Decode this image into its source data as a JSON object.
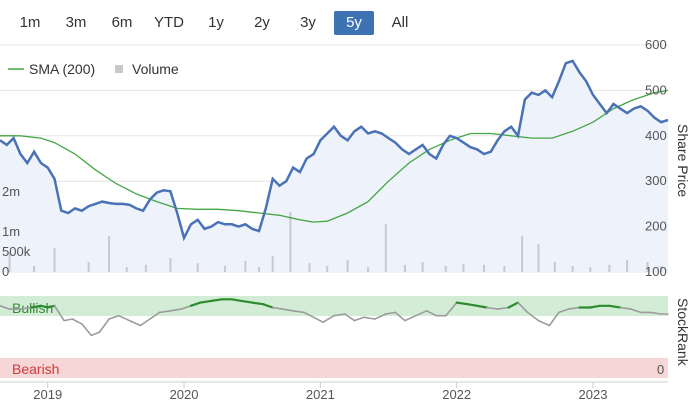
{
  "range_selector": {
    "buttons": [
      {
        "label": "1m"
      },
      {
        "label": "3m"
      },
      {
        "label": "6m"
      },
      {
        "label": "YTD"
      },
      {
        "label": "1y"
      },
      {
        "label": "2y"
      },
      {
        "label": "3y"
      },
      {
        "label": "5y"
      },
      {
        "label": "All"
      }
    ],
    "active": "5y"
  },
  "colors": {
    "price": "#4a72b6",
    "price_fill": "#eef2fa",
    "sma": "#44a744",
    "volume": "#c9c9cb",
    "stockrank_neutral": "#9c9c9c",
    "stockrank_bullish": "#2e8b2e",
    "bullish_band": "#d2ecd6",
    "bearish_band": "#f6d6d6"
  },
  "chart_data": [
    {
      "type": "line",
      "legend": [
        {
          "name": "SMA (200)",
          "marker": "line"
        },
        {
          "name": "Volume",
          "marker": "square"
        }
      ],
      "y_right_label": "Share Price",
      "y_right_ticks": [
        "600",
        "500",
        "400",
        "300",
        "200",
        "100"
      ],
      "y_right_range": [
        100,
        600
      ],
      "y_left_ticks": [
        "2m",
        "1m",
        "500k",
        "0"
      ],
      "y_left_range": [
        0,
        3000000
      ],
      "x_ticks": [
        "2019",
        "2020",
        "2021",
        "2022",
        "2023"
      ],
      "x_range": [
        2018.65,
        2023.55
      ],
      "grid": true,
      "series": [
        {
          "name": "Share Price",
          "x": [
            2018.65,
            2018.7,
            2018.75,
            2018.8,
            2018.85,
            2018.9,
            2018.95,
            2019.0,
            2019.05,
            2019.1,
            2019.15,
            2019.2,
            2019.25,
            2019.3,
            2019.35,
            2019.4,
            2019.45,
            2019.5,
            2019.55,
            2019.6,
            2019.65,
            2019.7,
            2019.75,
            2019.8,
            2019.85,
            2019.9,
            2019.95,
            2020.0,
            2020.05,
            2020.1,
            2020.15,
            2020.2,
            2020.25,
            2020.3,
            2020.35,
            2020.4,
            2020.45,
            2020.5,
            2020.55,
            2020.6,
            2020.65,
            2020.7,
            2020.75,
            2020.8,
            2020.85,
            2020.9,
            2020.95,
            2021.0,
            2021.05,
            2021.1,
            2021.15,
            2021.2,
            2021.25,
            2021.3,
            2021.35,
            2021.4,
            2021.45,
            2021.5,
            2021.55,
            2021.6,
            2021.65,
            2021.7,
            2021.75,
            2021.8,
            2021.85,
            2021.9,
            2021.95,
            2022.0,
            2022.05,
            2022.1,
            2022.15,
            2022.2,
            2022.25,
            2022.3,
            2022.35,
            2022.4,
            2022.45,
            2022.5,
            2022.55,
            2022.6,
            2022.65,
            2022.7,
            2022.75,
            2022.8,
            2022.85,
            2022.9,
            2022.95,
            2023.0,
            2023.05,
            2023.1,
            2023.15,
            2023.2,
            2023.25,
            2023.3,
            2023.35,
            2023.4,
            2023.45,
            2023.5,
            2023.55
          ],
          "y": [
            390,
            380,
            395,
            360,
            340,
            365,
            340,
            330,
            305,
            235,
            230,
            240,
            235,
            245,
            250,
            255,
            252,
            250,
            250,
            248,
            240,
            235,
            260,
            275,
            280,
            278,
            230,
            175,
            205,
            215,
            195,
            200,
            210,
            205,
            205,
            200,
            205,
            195,
            190,
            240,
            305,
            290,
            300,
            330,
            320,
            350,
            360,
            390,
            405,
            420,
            400,
            390,
            410,
            420,
            405,
            410,
            405,
            395,
            385,
            370,
            360,
            370,
            380,
            360,
            350,
            380,
            400,
            395,
            385,
            375,
            370,
            360,
            365,
            390,
            410,
            420,
            400,
            480,
            495,
            490,
            500,
            485,
            520,
            560,
            565,
            540,
            520,
            490,
            470,
            450,
            470,
            460,
            450,
            460,
            465,
            455,
            440,
            430,
            435
          ]
        },
        {
          "name": "SMA (200)",
          "x": [
            2018.65,
            2018.8,
            2018.95,
            2019.05,
            2019.2,
            2019.35,
            2019.5,
            2019.65,
            2019.8,
            2019.95,
            2020.1,
            2020.25,
            2020.4,
            2020.55,
            2020.7,
            2020.85,
            2020.95,
            2021.05,
            2021.2,
            2021.35,
            2021.5,
            2021.65,
            2021.8,
            2021.95,
            2022.1,
            2022.25,
            2022.4,
            2022.55,
            2022.7,
            2022.85,
            2023.0,
            2023.15,
            2023.3,
            2023.45,
            2023.55
          ],
          "y": [
            400,
            400,
            395,
            385,
            360,
            325,
            295,
            272,
            255,
            240,
            238,
            238,
            235,
            230,
            225,
            215,
            210,
            212,
            230,
            255,
            300,
            340,
            370,
            390,
            405,
            405,
            400,
            395,
            395,
            410,
            430,
            460,
            480,
            495,
            500
          ]
        }
      ],
      "volume": {
        "x": [
          2018.72,
          2018.9,
          2019.05,
          2019.3,
          2019.45,
          2019.58,
          2019.72,
          2019.9,
          2020.1,
          2020.3,
          2020.45,
          2020.55,
          2020.65,
          2020.78,
          2020.92,
          2021.05,
          2021.2,
          2021.35,
          2021.48,
          2021.62,
          2021.75,
          2021.92,
          2022.05,
          2022.2,
          2022.35,
          2022.48,
          2022.6,
          2022.72,
          2022.85,
          2022.98,
          2023.12,
          2023.25,
          2023.4,
          2023.5
        ],
        "y": [
          500000,
          150000,
          600000,
          250000,
          900000,
          120000,
          180000,
          350000,
          220000,
          160000,
          280000,
          120000,
          400000,
          1500000,
          220000,
          150000,
          300000,
          120000,
          1200000,
          180000,
          250000,
          150000,
          200000,
          180000,
          150000,
          900000,
          700000,
          250000,
          150000,
          120000,
          180000,
          300000,
          250000,
          150000
        ]
      }
    },
    {
      "type": "line",
      "y_right_label": "StockRank",
      "zones": [
        {
          "label": "Bullish"
        },
        {
          "label": "Bearish"
        }
      ],
      "y_right_ticks": [
        "0"
      ],
      "y_range": [
        0,
        100
      ],
      "series": [
        {
          "name": "StockRank",
          "x": [
            2018.65,
            2018.72,
            2018.8,
            2018.88,
            2018.95,
            2019.0,
            2019.05,
            2019.12,
            2019.18,
            2019.25,
            2019.32,
            2019.38,
            2019.45,
            2019.52,
            2019.6,
            2019.68,
            2019.75,
            2019.82,
            2019.9,
            2019.98,
            2020.05,
            2020.12,
            2020.2,
            2020.28,
            2020.35,
            2020.42,
            2020.5,
            2020.58,
            2020.65,
            2020.72,
            2020.8,
            2020.88,
            2020.95,
            2021.02,
            2021.1,
            2021.18,
            2021.25,
            2021.32,
            2021.4,
            2021.48,
            2021.55,
            2021.62,
            2021.7,
            2021.78,
            2021.85,
            2021.92,
            2022.0,
            2022.08,
            2022.15,
            2022.22,
            2022.3,
            2022.38,
            2022.45,
            2022.52,
            2022.6,
            2022.68,
            2022.75,
            2022.82,
            2022.9,
            2022.98,
            2023.05,
            2023.12,
            2023.2,
            2023.28,
            2023.35,
            2023.42,
            2023.5,
            2023.55
          ],
          "y": [
            88,
            84,
            84,
            86,
            88,
            86,
            88,
            70,
            72,
            66,
            52,
            56,
            72,
            76,
            70,
            64,
            72,
            80,
            82,
            84,
            88,
            92,
            94,
            96,
            96,
            94,
            92,
            90,
            86,
            84,
            82,
            80,
            74,
            68,
            76,
            78,
            70,
            74,
            72,
            78,
            80,
            70,
            76,
            82,
            76,
            76,
            92,
            90,
            88,
            86,
            84,
            86,
            92,
            80,
            70,
            64,
            80,
            84,
            86,
            86,
            88,
            88,
            86,
            84,
            80,
            80,
            78,
            78
          ]
        }
      ],
      "x_ticks": [
        "2019",
        "2020",
        "2021",
        "2022",
        "2023"
      ]
    }
  ]
}
